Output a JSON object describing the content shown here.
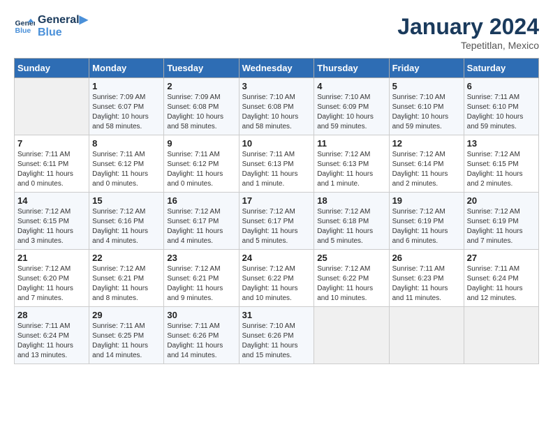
{
  "header": {
    "logo_line1": "General",
    "logo_line2": "Blue",
    "month_title": "January 2024",
    "location": "Tepetitlan, Mexico"
  },
  "weekdays": [
    "Sunday",
    "Monday",
    "Tuesday",
    "Wednesday",
    "Thursday",
    "Friday",
    "Saturday"
  ],
  "weeks": [
    [
      {
        "day": "",
        "info": ""
      },
      {
        "day": "1",
        "info": "Sunrise: 7:09 AM\nSunset: 6:07 PM\nDaylight: 10 hours\nand 58 minutes."
      },
      {
        "day": "2",
        "info": "Sunrise: 7:09 AM\nSunset: 6:08 PM\nDaylight: 10 hours\nand 58 minutes."
      },
      {
        "day": "3",
        "info": "Sunrise: 7:10 AM\nSunset: 6:08 PM\nDaylight: 10 hours\nand 58 minutes."
      },
      {
        "day": "4",
        "info": "Sunrise: 7:10 AM\nSunset: 6:09 PM\nDaylight: 10 hours\nand 59 minutes."
      },
      {
        "day": "5",
        "info": "Sunrise: 7:10 AM\nSunset: 6:10 PM\nDaylight: 10 hours\nand 59 minutes."
      },
      {
        "day": "6",
        "info": "Sunrise: 7:11 AM\nSunset: 6:10 PM\nDaylight: 10 hours\nand 59 minutes."
      }
    ],
    [
      {
        "day": "7",
        "info": "Sunrise: 7:11 AM\nSunset: 6:11 PM\nDaylight: 11 hours\nand 0 minutes."
      },
      {
        "day": "8",
        "info": "Sunrise: 7:11 AM\nSunset: 6:12 PM\nDaylight: 11 hours\nand 0 minutes."
      },
      {
        "day": "9",
        "info": "Sunrise: 7:11 AM\nSunset: 6:12 PM\nDaylight: 11 hours\nand 0 minutes."
      },
      {
        "day": "10",
        "info": "Sunrise: 7:11 AM\nSunset: 6:13 PM\nDaylight: 11 hours\nand 1 minute."
      },
      {
        "day": "11",
        "info": "Sunrise: 7:12 AM\nSunset: 6:13 PM\nDaylight: 11 hours\nand 1 minute."
      },
      {
        "day": "12",
        "info": "Sunrise: 7:12 AM\nSunset: 6:14 PM\nDaylight: 11 hours\nand 2 minutes."
      },
      {
        "day": "13",
        "info": "Sunrise: 7:12 AM\nSunset: 6:15 PM\nDaylight: 11 hours\nand 2 minutes."
      }
    ],
    [
      {
        "day": "14",
        "info": "Sunrise: 7:12 AM\nSunset: 6:15 PM\nDaylight: 11 hours\nand 3 minutes."
      },
      {
        "day": "15",
        "info": "Sunrise: 7:12 AM\nSunset: 6:16 PM\nDaylight: 11 hours\nand 4 minutes."
      },
      {
        "day": "16",
        "info": "Sunrise: 7:12 AM\nSunset: 6:17 PM\nDaylight: 11 hours\nand 4 minutes."
      },
      {
        "day": "17",
        "info": "Sunrise: 7:12 AM\nSunset: 6:17 PM\nDaylight: 11 hours\nand 5 minutes."
      },
      {
        "day": "18",
        "info": "Sunrise: 7:12 AM\nSunset: 6:18 PM\nDaylight: 11 hours\nand 5 minutes."
      },
      {
        "day": "19",
        "info": "Sunrise: 7:12 AM\nSunset: 6:19 PM\nDaylight: 11 hours\nand 6 minutes."
      },
      {
        "day": "20",
        "info": "Sunrise: 7:12 AM\nSunset: 6:19 PM\nDaylight: 11 hours\nand 7 minutes."
      }
    ],
    [
      {
        "day": "21",
        "info": "Sunrise: 7:12 AM\nSunset: 6:20 PM\nDaylight: 11 hours\nand 7 minutes."
      },
      {
        "day": "22",
        "info": "Sunrise: 7:12 AM\nSunset: 6:21 PM\nDaylight: 11 hours\nand 8 minutes."
      },
      {
        "day": "23",
        "info": "Sunrise: 7:12 AM\nSunset: 6:21 PM\nDaylight: 11 hours\nand 9 minutes."
      },
      {
        "day": "24",
        "info": "Sunrise: 7:12 AM\nSunset: 6:22 PM\nDaylight: 11 hours\nand 10 minutes."
      },
      {
        "day": "25",
        "info": "Sunrise: 7:12 AM\nSunset: 6:22 PM\nDaylight: 11 hours\nand 10 minutes."
      },
      {
        "day": "26",
        "info": "Sunrise: 7:11 AM\nSunset: 6:23 PM\nDaylight: 11 hours\nand 11 minutes."
      },
      {
        "day": "27",
        "info": "Sunrise: 7:11 AM\nSunset: 6:24 PM\nDaylight: 11 hours\nand 12 minutes."
      }
    ],
    [
      {
        "day": "28",
        "info": "Sunrise: 7:11 AM\nSunset: 6:24 PM\nDaylight: 11 hours\nand 13 minutes."
      },
      {
        "day": "29",
        "info": "Sunrise: 7:11 AM\nSunset: 6:25 PM\nDaylight: 11 hours\nand 14 minutes."
      },
      {
        "day": "30",
        "info": "Sunrise: 7:11 AM\nSunset: 6:26 PM\nDaylight: 11 hours\nand 14 minutes."
      },
      {
        "day": "31",
        "info": "Sunrise: 7:10 AM\nSunset: 6:26 PM\nDaylight: 11 hours\nand 15 minutes."
      },
      {
        "day": "",
        "info": ""
      },
      {
        "day": "",
        "info": ""
      },
      {
        "day": "",
        "info": ""
      }
    ]
  ]
}
